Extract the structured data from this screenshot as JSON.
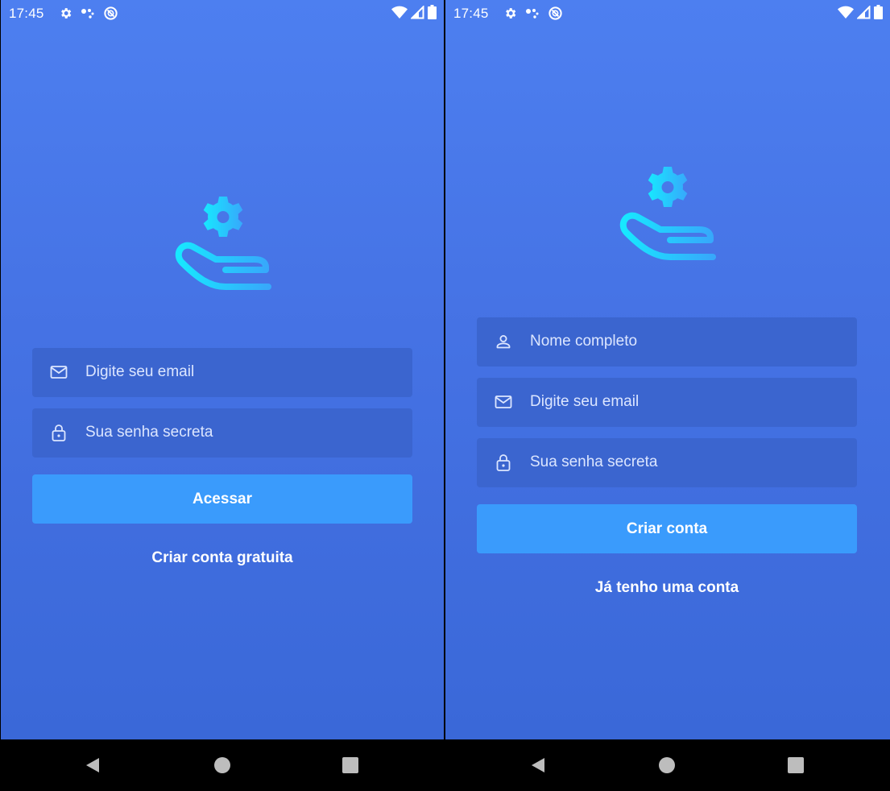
{
  "status_bar": {
    "time": "17:45",
    "icons_left": [
      "gear-icon",
      "dots-icon",
      "do-not-disturb-icon"
    ],
    "icons_right": [
      "wifi-icon",
      "cell-signal-icon",
      "battery-icon"
    ]
  },
  "login": {
    "email_placeholder": "Digite seu email",
    "password_placeholder": "Sua senha secreta",
    "submit_label": "Acessar",
    "alt_link": "Criar conta gratuita"
  },
  "signup": {
    "name_placeholder": "Nome completo",
    "email_placeholder": "Digite seu email",
    "password_placeholder": "Sua senha secreta",
    "submit_label": "Criar conta",
    "alt_link": "Já tenho uma conta"
  },
  "logo_icon": "hand-holding-gear-icon",
  "colors": {
    "gradient_top": "#4d7ff0",
    "gradient_bottom": "#3a68d8",
    "field_bg": "#3b65cf",
    "button_bg": "#3a9bfc",
    "logo_gradient": [
      "#00e5ff",
      "#3a9bfc"
    ]
  },
  "nav_bar": {
    "icons": [
      "back-icon",
      "home-icon",
      "recents-icon"
    ]
  }
}
